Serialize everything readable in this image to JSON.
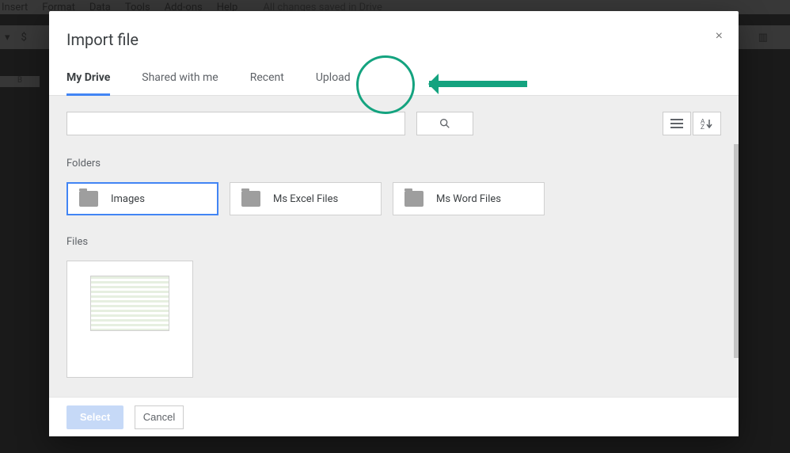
{
  "background": {
    "menus": [
      "Insert",
      "Format",
      "Data",
      "Tools",
      "Add-ons",
      "Help"
    ],
    "save_status": "All changes saved in Drive",
    "toolbar_dollar": "$",
    "col_letter": "B"
  },
  "dialog": {
    "title": "Import file",
    "tabs": [
      {
        "label": "My Drive",
        "active": true
      },
      {
        "label": "Shared with me",
        "active": false
      },
      {
        "label": "Recent",
        "active": false
      },
      {
        "label": "Upload",
        "active": false
      }
    ],
    "sections": {
      "folders_label": "Folders",
      "files_label": "Files"
    },
    "folders": [
      {
        "label": "Images",
        "selected": true
      },
      {
        "label": "Ms Excel Files",
        "selected": false
      },
      {
        "label": "Ms Word Files",
        "selected": false
      }
    ],
    "buttons": {
      "select": "Select",
      "cancel": "Cancel"
    }
  }
}
